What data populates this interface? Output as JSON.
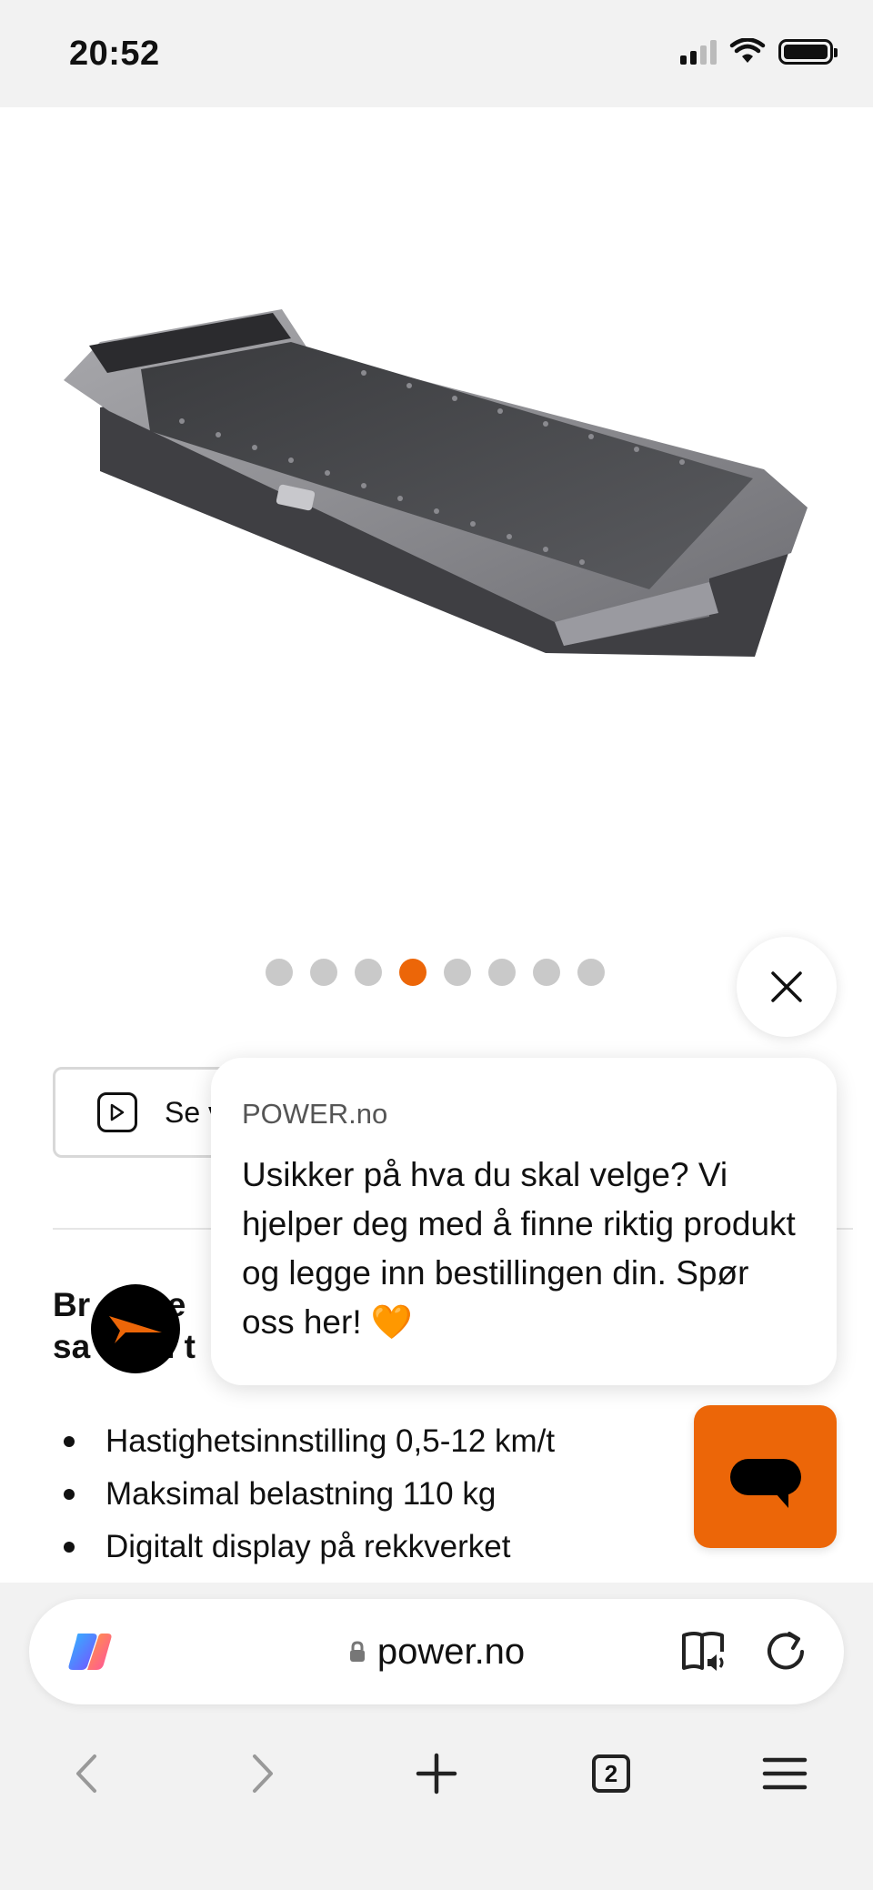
{
  "status_bar": {
    "time": "20:52",
    "icons": [
      "cellular-signal-icon",
      "wifi-icon",
      "battery-icon"
    ]
  },
  "product": {
    "image_alt": "treadmill-image",
    "carousel": {
      "total": 8,
      "active_index": 4
    },
    "video_button_label": "Se v",
    "section_title_line1": "Br",
    "section_title_mid": "ve",
    "section_title_line2_a": "sa",
    "section_title_line2_b": "en t",
    "features": [
      "Hastighetsinnstilling 0,5-12 km/t",
      "Maksimal belastning 110 kg",
      "Digitalt display på rekkverket"
    ]
  },
  "chat": {
    "source": "POWER.no",
    "message": "Usikker på hva du skal velge? Vi hjelper deg med å finne riktig produkt og legge inn bestillingen din. Spør oss her! 🧡",
    "accent_color": "#ec6608"
  },
  "browser": {
    "url": "power.no",
    "tab_count": "2",
    "toolbar_icons": [
      "back-icon",
      "forward-icon",
      "new-tab-icon",
      "tabs-icon",
      "menu-icon"
    ]
  }
}
